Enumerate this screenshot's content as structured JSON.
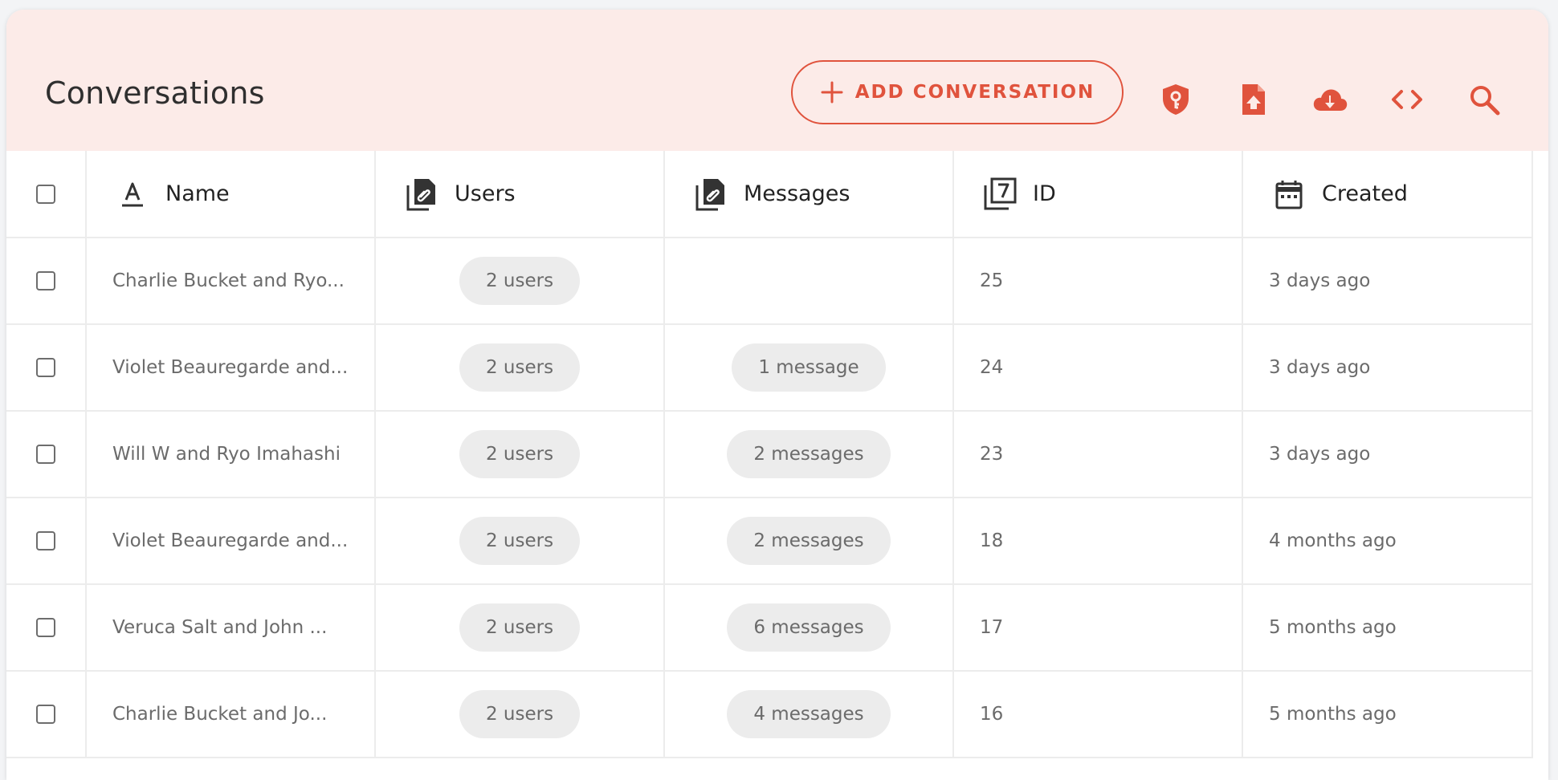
{
  "header": {
    "title": "Conversations",
    "add_button_label": "ADD CONVERSATION",
    "accent_color": "#e0533d",
    "tools": [
      "shield-key-icon",
      "file-upload-icon",
      "cloud-download-icon",
      "code-icon",
      "search-icon"
    ]
  },
  "table": {
    "columns": [
      {
        "label": "Name",
        "icon": "text-format-icon"
      },
      {
        "label": "Users",
        "icon": "linked-files-icon"
      },
      {
        "label": "Messages",
        "icon": "linked-files-icon"
      },
      {
        "label": "ID",
        "icon": "numbered-stack-icon"
      },
      {
        "label": "Created",
        "icon": "calendar-icon"
      }
    ],
    "rows": [
      {
        "name": "Charlie Bucket and Ryo...",
        "users": "2 users",
        "messages": "",
        "id": "25",
        "created": "3 days ago"
      },
      {
        "name": "Violet Beauregarde and...",
        "users": "2 users",
        "messages": "1 message",
        "id": "24",
        "created": "3 days ago"
      },
      {
        "name": "Will W and Ryo Imahashi",
        "users": "2 users",
        "messages": "2 messages",
        "id": "23",
        "created": "3 days ago"
      },
      {
        "name": "Violet Beauregarde and...",
        "users": "2 users",
        "messages": "2 messages",
        "id": "18",
        "created": "4 months ago"
      },
      {
        "name": "Veruca Salt and John ...",
        "users": "2 users",
        "messages": "6 messages",
        "id": "17",
        "created": "5 months ago"
      },
      {
        "name": "Charlie Bucket and Jo...",
        "users": "2 users",
        "messages": "4 messages",
        "id": "16",
        "created": "5 months ago"
      }
    ]
  }
}
